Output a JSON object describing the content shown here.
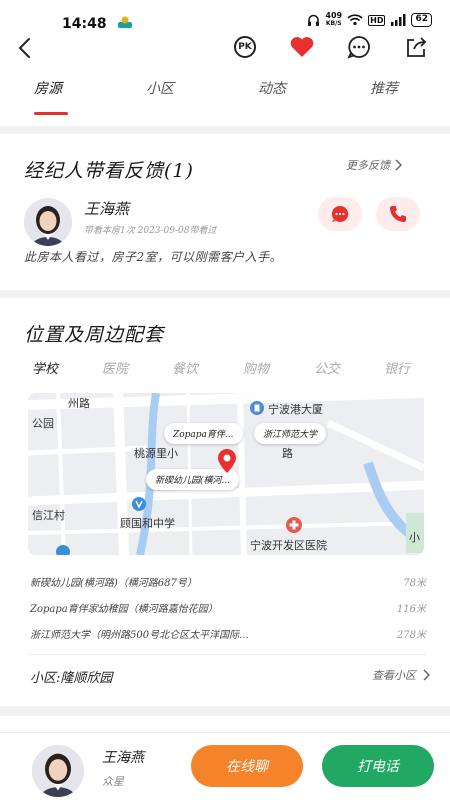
{
  "status_bar": {
    "time": "14:48",
    "net_speed_value": "409",
    "net_speed_unit": "KB/S",
    "hd": "HD",
    "battery": "62"
  },
  "nav": {
    "icons": [
      "back-icon",
      "pk-icon",
      "heart-icon",
      "chat-icon",
      "share-icon"
    ],
    "pk_label": "PK",
    "heart_color": "#e8302f"
  },
  "tabs": [
    {
      "label": "房源",
      "active": true
    },
    {
      "label": "小区",
      "active": false
    },
    {
      "label": "动态",
      "active": false
    },
    {
      "label": "推荐",
      "active": false
    }
  ],
  "feedback": {
    "title": "经纪人带看反馈(1)",
    "more": "更多反馈",
    "agent": {
      "name": "王海燕",
      "subtitle": "带看本房1次 2023-09-08带看过"
    },
    "comment": "此房本人看过，房子2室，可以刚需客户入手。"
  },
  "location": {
    "title": "位置及周边配套",
    "poi_tabs": [
      "学校",
      "医院",
      "餐饮",
      "购物",
      "公交",
      "银行"
    ],
    "map": {
      "labels": [
        "州路",
        "公园",
        "宁波港大厦",
        "桃源里小",
        "路",
        "信江村",
        "顾国和中学",
        "宁波开发区医院",
        "小"
      ],
      "bubbles": [
        "Zopapa育伴...",
        "浙江师范大学",
        "新碶幼儿园(横河..."
      ],
      "pin_color": "#e8302f"
    },
    "pois": [
      {
        "name": "新碶幼儿园(横河路)（横河路687号）",
        "distance": "78米"
      },
      {
        "name": "Zopapa育伴家幼稚园（横河路嘉怡花园）",
        "distance": "116米"
      },
      {
        "name": "浙江师范大学（明州路500号北仑区太平洋国际...",
        "distance": "278米"
      }
    ]
  },
  "community": {
    "label": "小区:隆顺欣园",
    "link": "查看小区"
  },
  "bottom_bar": {
    "name": "王海燕",
    "role": "众星",
    "chat_label": "在线聊",
    "chat_color": "#f5832a",
    "call_label": "打电话",
    "call_color": "#21a862"
  }
}
